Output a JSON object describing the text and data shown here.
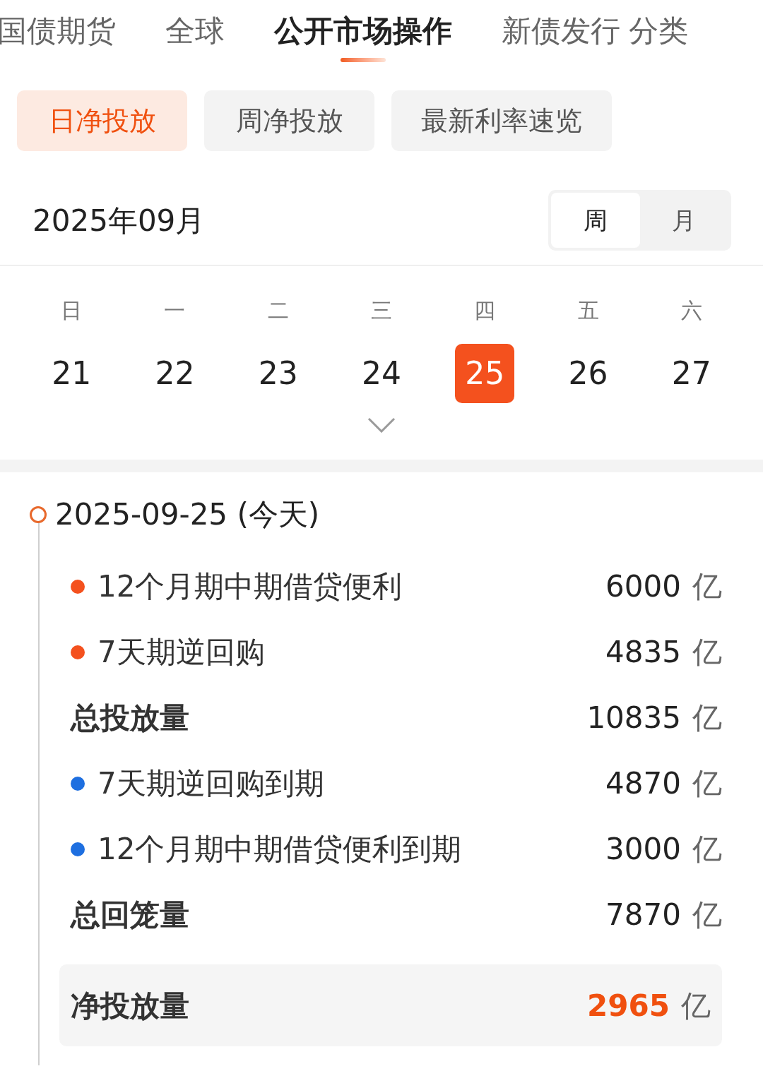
{
  "top_tabs": [
    {
      "label": "国债期货",
      "selected": false
    },
    {
      "label": "全球",
      "selected": false
    },
    {
      "label": "公开市场操作",
      "selected": true
    },
    {
      "label": "新债发行",
      "selected": false
    },
    {
      "label": "分类",
      "selected": false
    }
  ],
  "sub_tabs": [
    {
      "label": "日净投放",
      "selected": true
    },
    {
      "label": "周净投放",
      "selected": false
    },
    {
      "label": "最新利率速览",
      "selected": false
    }
  ],
  "month": "2025年09月",
  "view_toggle": [
    {
      "label": "周",
      "selected": true
    },
    {
      "label": "月",
      "selected": false
    }
  ],
  "calendar": {
    "days": [
      {
        "weekday": "日",
        "date": "21",
        "selected": false
      },
      {
        "weekday": "一",
        "date": "22",
        "selected": false
      },
      {
        "weekday": "二",
        "date": "23",
        "selected": false
      },
      {
        "weekday": "三",
        "date": "24",
        "selected": false
      },
      {
        "weekday": "四",
        "date": "25",
        "selected": true
      },
      {
        "weekday": "五",
        "date": "26",
        "selected": false
      },
      {
        "weekday": "六",
        "date": "27",
        "selected": false
      }
    ]
  },
  "timeline": {
    "date": "2025-09-25 (今天)",
    "rows": [
      {
        "kind": "item",
        "color": "#f4511e",
        "label": "12个月期中期借贷便利",
        "value": "6000",
        "unit": "亿"
      },
      {
        "kind": "item",
        "color": "#f4511e",
        "label": "7天期逆回购",
        "value": "4835",
        "unit": "亿"
      },
      {
        "kind": "total",
        "label": "总投放量",
        "value": "10835",
        "unit": "亿"
      },
      {
        "kind": "item",
        "color": "#1e6fe0",
        "label": "7天期逆回购到期",
        "value": "4870",
        "unit": "亿"
      },
      {
        "kind": "item",
        "color": "#1e6fe0",
        "label": "12个月期中期借贷便利到期",
        "value": "3000",
        "unit": "亿"
      },
      {
        "kind": "total",
        "label": "总回笼量",
        "value": "7870",
        "unit": "亿"
      },
      {
        "kind": "net",
        "label": "净投放量",
        "value": "2965",
        "unit": "亿"
      }
    ]
  }
}
